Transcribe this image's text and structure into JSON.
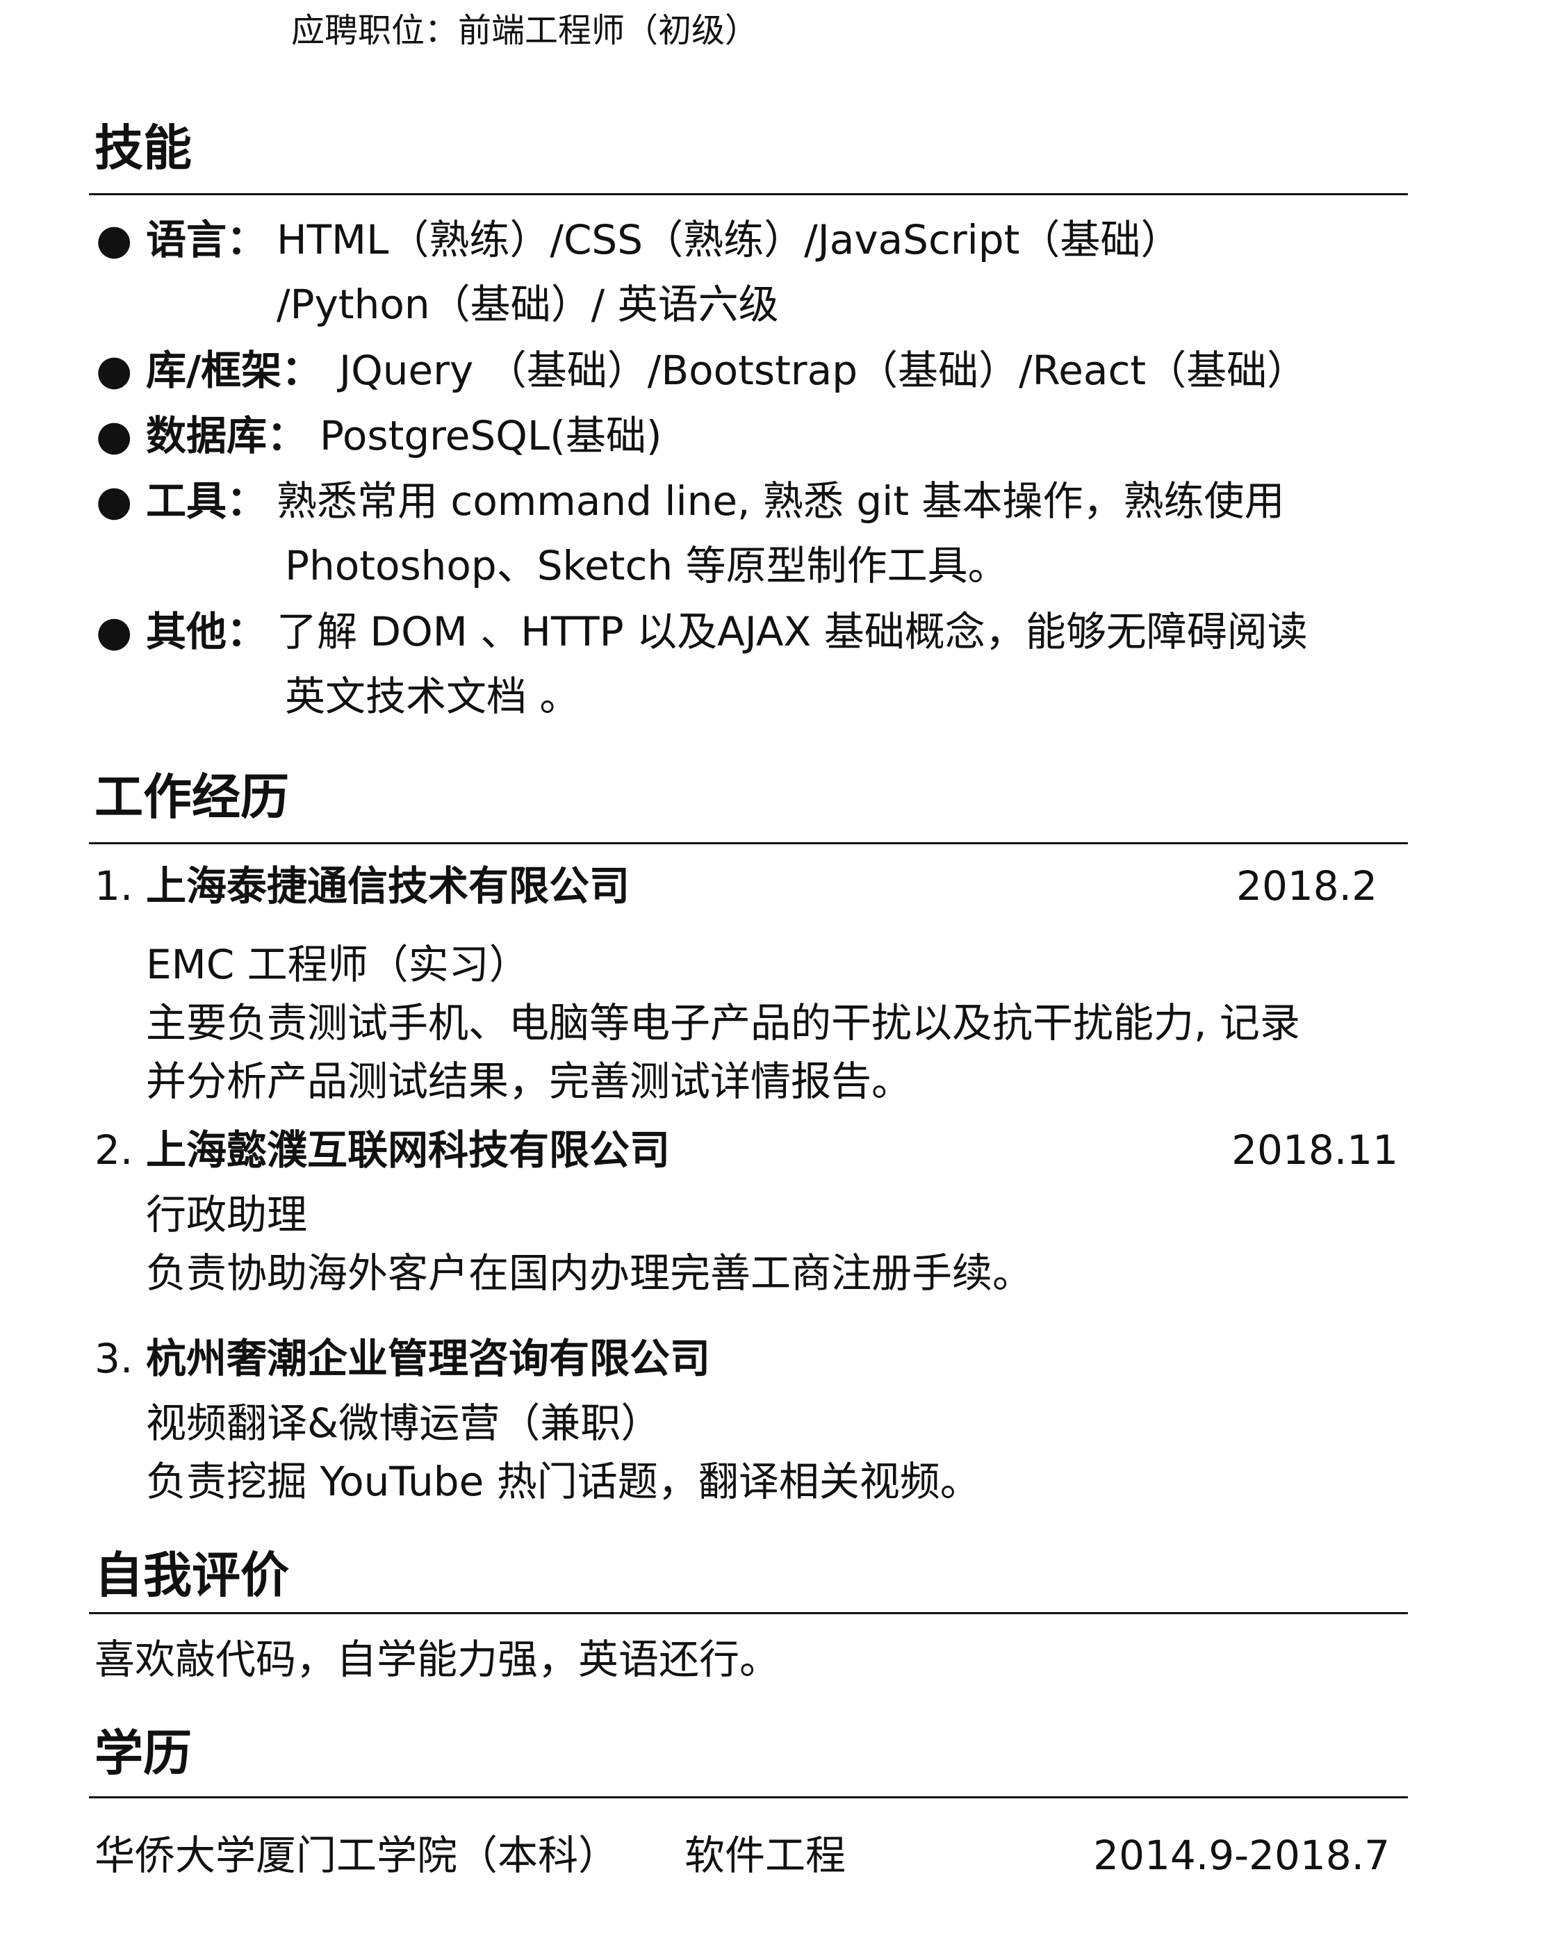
{
  "position": "应聘职位：前端工程师（初级）",
  "skills": {
    "heading": "技能",
    "items": [
      {
        "label": "语言：",
        "lines": [
          "HTML（熟练）/CSS（熟练）/JavaScript（基础）",
          "/Python（基础）/ 英语六级"
        ]
      },
      {
        "label": "库/框架：",
        "lines": [
          "JQuery （基础）/Bootstrap（基础）/React（基础）"
        ]
      },
      {
        "label": "数据库：",
        "lines": [
          "PostgreSQL(基础)"
        ]
      },
      {
        "label": "工具：",
        "lines": [
          "熟悉常用 command line, 熟悉 git 基本操作，熟练使用",
          "Photoshop、Sketch 等原型制作工具。"
        ]
      },
      {
        "label": "其他：",
        "lines": [
          "了解 DOM 、HTTP 以及AJAX 基础概念，能够无障碍阅读",
          "英文技术文档 。"
        ]
      }
    ]
  },
  "work": {
    "heading": "工作经历",
    "jobs": [
      {
        "number": "1.",
        "company": "上海泰捷通信技术有限公司",
        "date": "2018.2",
        "role": "EMC 工程师（实习）",
        "desc": [
          "主要负责测试手机、电脑等电子产品的干扰以及抗干扰能力, 记录",
          "并分析产品测试结果，完善测试详情报告。"
        ]
      },
      {
        "number": "2.",
        "company": "上海懿濮互联网科技有限公司",
        "date": "2018.11",
        "role": "行政助理",
        "desc": [
          "负责协助海外客户在国内办理完善工商注册手续。"
        ]
      },
      {
        "number": "3.",
        "company": "杭州奢潮企业管理咨询有限公司",
        "date": "",
        "role": "视频翻译&微博运营（兼职）",
        "desc": [
          "负责挖掘 YouTube 热门话题，翻译相关视频。"
        ]
      }
    ]
  },
  "self_eval": {
    "heading": "自我评价",
    "text": "喜欢敲代码，自学能力强，英语还行。"
  },
  "education": {
    "heading": "学历",
    "school": "华侨大学厦门工学院（本科）",
    "major": "软件工程",
    "period": "2014.9-2018.7"
  }
}
